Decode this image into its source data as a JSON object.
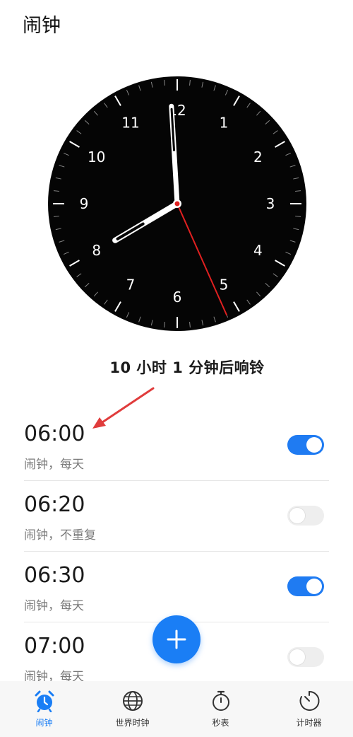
{
  "app": {
    "title": "闹钟"
  },
  "clock": {
    "hour": 7,
    "minute": 59,
    "second": 26,
    "numbers": [
      "1",
      "2",
      "3",
      "4",
      "5",
      "6",
      "7",
      "8",
      "9",
      "10",
      "11",
      "12"
    ]
  },
  "countdown_text": "10 小时 1 分钟后响铃",
  "alarms": [
    {
      "time": "06:00",
      "desc": "闹钟，每天",
      "enabled": true
    },
    {
      "time": "06:20",
      "desc": "闹钟，不重复",
      "enabled": false
    },
    {
      "time": "06:30",
      "desc": "闹钟，每天",
      "enabled": true
    },
    {
      "time": "07:00",
      "desc": "闹钟，每天",
      "enabled": false
    }
  ],
  "nav": [
    {
      "label": "闹钟",
      "icon": "alarm-clock-icon",
      "active": true
    },
    {
      "label": "世界时钟",
      "icon": "globe-icon",
      "active": false
    },
    {
      "label": "秒表",
      "icon": "stopwatch-icon",
      "active": false
    },
    {
      "label": "计时器",
      "icon": "timer-icon",
      "active": false
    }
  ],
  "colors": {
    "accent": "#1a7ef5",
    "second_hand": "#e02020",
    "clock_face": "#050505"
  }
}
